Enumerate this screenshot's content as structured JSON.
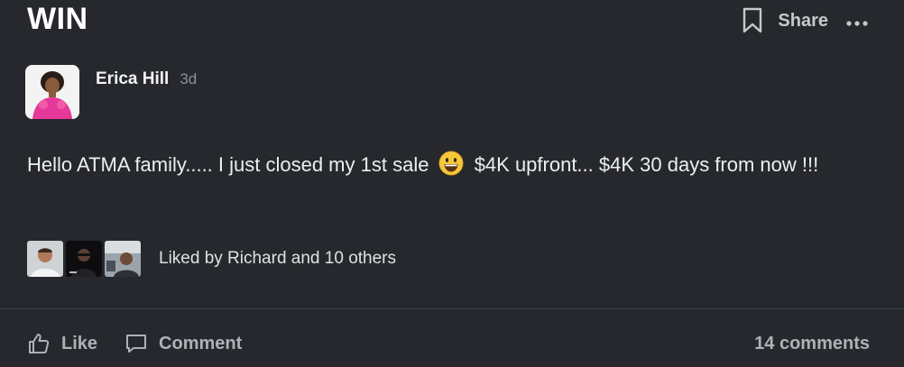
{
  "post": {
    "title": "WIN",
    "share_label": "Share",
    "author": {
      "name": "Erica Hill",
      "time": "3d"
    },
    "body": {
      "text_before_emoji": "Hello ATMA family..... I just closed my 1st sale",
      "emoji": "grinning-face-emoji",
      "text_after_emoji": "$4K upfront... $4K 30 days from now !!!"
    },
    "likes": {
      "text": "Liked by Richard and 10 others",
      "avatar_count": 3
    },
    "actions": {
      "like_label": "Like",
      "comment_label": "Comment",
      "comments_count": "14 comments"
    }
  },
  "colors": {
    "background": "#26282d",
    "text_primary": "#eceef0",
    "text_secondary": "#aeb1b6",
    "muted": "#8e9197",
    "avatar_accent": "#e5389a",
    "divider": "#3d4046"
  }
}
